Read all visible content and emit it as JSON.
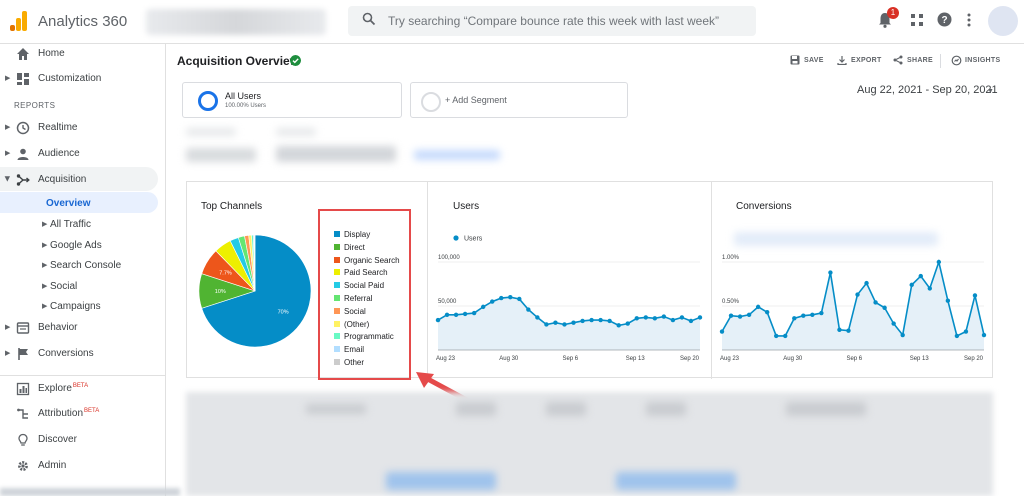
{
  "app": {
    "title": "Analytics 360",
    "logo_colors": [
      "#f9ab00",
      "#e37400"
    ]
  },
  "search": {
    "placeholder": "Try searching “Compare bounce rate this week with last week”"
  },
  "notifications": {
    "count": "1"
  },
  "sidebar": {
    "home": "Home",
    "customization": "Customization",
    "reports_section": "REPORTS",
    "realtime": "Realtime",
    "audience": "Audience",
    "acquisition": "Acquisition",
    "overview": "Overview",
    "all_traffic": "All Traffic",
    "google_ads": "Google Ads",
    "search_console": "Search Console",
    "social": "Social",
    "campaigns": "Campaigns",
    "behavior": "Behavior",
    "conversions": "Conversions",
    "explore": "Explore",
    "explore_badge": "BETA",
    "attribution": "Attribution",
    "attribution_badge": "BETA",
    "discover": "Discover",
    "admin": "Admin"
  },
  "header": {
    "title": "Acquisition Overview",
    "save": "SAVE",
    "export": "EXPORT",
    "share": "SHARE",
    "insights": "INSIGHTS",
    "date_range": "Aug 22, 2021 - Sep 20, 2021"
  },
  "segments": {
    "active_name": "All Users",
    "active_sub": "100.00% Users",
    "add_label": "+ Add Segment"
  },
  "panels": {
    "top_channels_title": "Top Channels",
    "users_title": "Users",
    "conversions_title": "Conversions"
  },
  "chart_data": [
    {
      "type": "pie",
      "title": "Top Channels",
      "labels": [
        "Display",
        "Direct",
        "Organic Search",
        "Paid Search",
        "Social Paid",
        "Referral",
        "Social",
        "(Other)",
        "Programmatic",
        "Email",
        "Other"
      ],
      "values": [
        70,
        10,
        7.7,
        5,
        2.5,
        1.8,
        1.2,
        0.8,
        0.5,
        0.3,
        0.2
      ],
      "data_labels": [
        "70%",
        "10%",
        "7.7%",
        "",
        "",
        "",
        "",
        "",
        "",
        "",
        ""
      ],
      "colors": [
        "#058dc7",
        "#50b432",
        "#ed561b",
        "#edef00",
        "#24cbe5",
        "#64e572",
        "#ff9655",
        "#fff263",
        "#6af9c4",
        "#b2deff",
        "#cccccc"
      ]
    },
    {
      "type": "line",
      "title": "Users",
      "series": [
        {
          "name": "Users",
          "values": [
            34000,
            40000,
            40000,
            41000,
            42000,
            49000,
            55000,
            59000,
            60000,
            58000,
            46000,
            37000,
            29000,
            31000,
            29000,
            31000,
            33000,
            34000,
            34000,
            33000,
            28000,
            30000,
            36000,
            37000,
            36000,
            38000,
            34000,
            37000,
            33000,
            37000
          ]
        }
      ],
      "x_tick_labels": [
        "Aug 23",
        "Aug 30",
        "Sep 6",
        "Sep 13",
        "Sep 20"
      ],
      "y_tick_labels": [
        "100,000",
        "50,000"
      ],
      "ylim": [
        0,
        100000
      ],
      "color": "#058dc7"
    },
    {
      "type": "line",
      "title": "Conversions",
      "series": [
        {
          "values": [
            0.21,
            0.39,
            0.38,
            0.4,
            0.49,
            0.43,
            0.16,
            0.16,
            0.36,
            0.39,
            0.4,
            0.42,
            0.88,
            0.23,
            0.22,
            0.63,
            0.76,
            0.54,
            0.48,
            0.3,
            0.17,
            0.74,
            0.84,
            0.7,
            1.0,
            0.56,
            0.16,
            0.21,
            0.62,
            0.17
          ]
        }
      ],
      "x_tick_labels": [
        "Aug 23",
        "Aug 30",
        "Sep 6",
        "Sep 13",
        "Sep 20"
      ],
      "y_tick_labels": [
        "1.00%",
        "0.50%"
      ],
      "ylim": [
        0,
        1.0
      ],
      "color": "#058dc7"
    }
  ]
}
